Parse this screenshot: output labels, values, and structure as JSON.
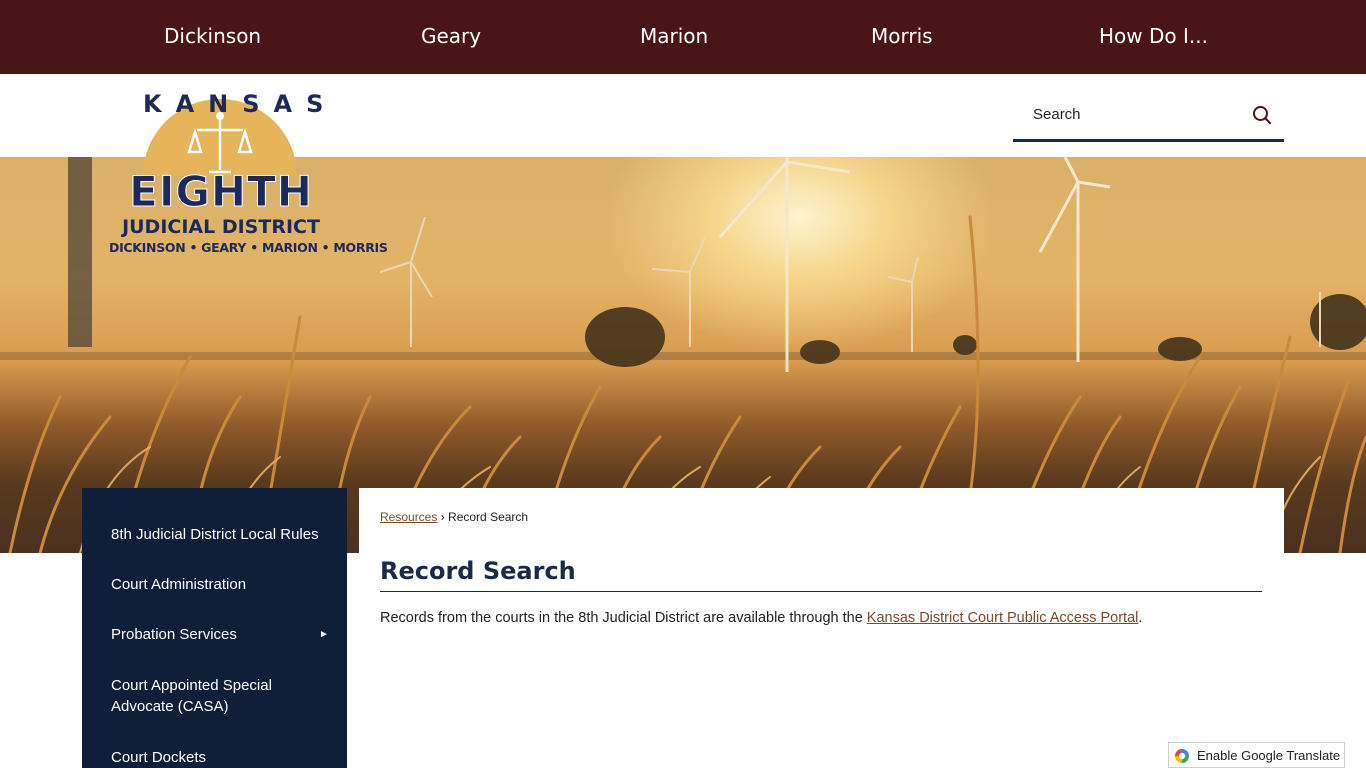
{
  "topnav": {
    "items": [
      "Dickinson",
      "Geary",
      "Marion",
      "Morris",
      "How Do I..."
    ]
  },
  "logo": {
    "line1": "KANSAS",
    "line2": "EIGHTH",
    "line3": "JUDICIAL DISTRICT",
    "line4": "DICKINSON • GEARY • MARION • MORRIS"
  },
  "search": {
    "placeholder": "Search"
  },
  "sidenav": {
    "items": [
      "8th Judicial District Local Rules",
      "Court Administration",
      "Probation Services",
      "Court Appointed Special Advocate (CASA)",
      "Court Dockets"
    ],
    "arrow": "►"
  },
  "breadcrumb": {
    "link": "Resources",
    "separator": "›",
    "current": "Record Search"
  },
  "page": {
    "title": "Record Search",
    "text_before": "Records from the courts in the 8th Judicial District are available through the ",
    "link": "Kansas District Court Public Access Portal",
    "text_after": "."
  },
  "translate": {
    "label": "Enable Google Translate"
  },
  "colors": {
    "nav_bg": "#4a1517",
    "navy": "#0f1f3a",
    "link": "#7a4a2a",
    "logo_gold": "#e6b45a",
    "logo_navy": "#1b2a5a"
  }
}
